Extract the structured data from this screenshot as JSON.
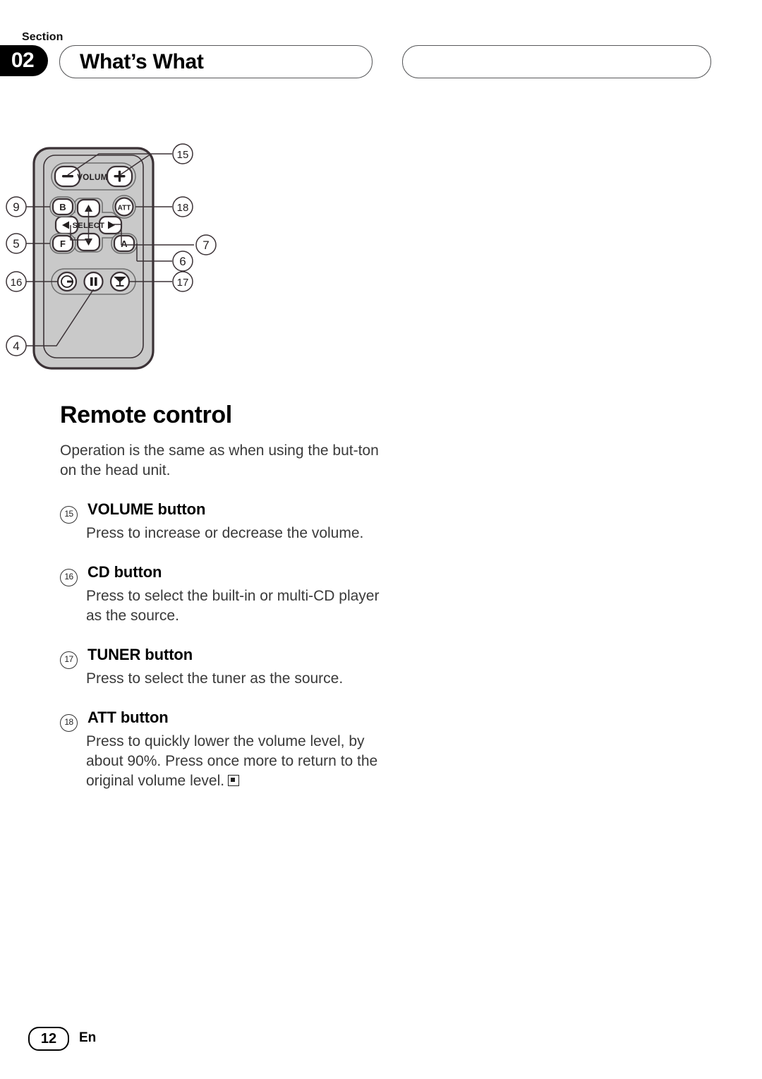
{
  "header": {
    "section_label": "Section",
    "section_number": "02",
    "chapter_title": "What’s What",
    "right_pill_text": ""
  },
  "figure": {
    "caption_alt": "remote-control-diagram",
    "remote": {
      "volume_label": "VOLUME",
      "select_label": "SELECT",
      "att_label": "ATT",
      "button_b": "B",
      "button_f": "F",
      "button_a": "A",
      "arrow_up": "▲",
      "arrow_down": "▼",
      "arrow_left": "◀",
      "arrow_right": "▶",
      "minus": "−",
      "plus": "+",
      "pause_icon": "pause-icon",
      "cd_source_icon": "cd-source-icon",
      "tuner_icon": "tuner-antenna-icon",
      "body_fill": "#c9c9c9",
      "body_stroke": "#3b3236"
    },
    "callouts": [
      {
        "id": "15",
        "side": "right",
        "targets": "volume-buttons"
      },
      {
        "id": "9",
        "side": "left",
        "targets": "button-b"
      },
      {
        "id": "18",
        "side": "right",
        "targets": "att-button"
      },
      {
        "id": "7",
        "side": "right",
        "targets": "select-pad"
      },
      {
        "id": "5",
        "side": "left",
        "targets": "button-f"
      },
      {
        "id": "6",
        "side": "right",
        "targets": "button-a"
      },
      {
        "id": "16",
        "side": "left",
        "targets": "cd-button"
      },
      {
        "id": "17",
        "side": "right",
        "targets": "tuner-button"
      },
      {
        "id": "4",
        "side": "left",
        "targets": "pause-button"
      }
    ]
  },
  "content": {
    "heading": "Remote control",
    "intro": "Operation is the same as when using the but-ton on the head unit.",
    "entries": [
      {
        "number": "15",
        "title": "VOLUME button",
        "description": "Press to increase or decrease the volume."
      },
      {
        "number": "16",
        "title": "CD button",
        "description": "Press to select the built-in or multi-CD player as the source."
      },
      {
        "number": "17",
        "title": "TUNER button",
        "description": "Press to select the tuner as the source."
      },
      {
        "number": "18",
        "title": "ATT button",
        "description": "Press to quickly lower the volume level, by about 90%. Press once more to return to the original volume level."
      }
    ],
    "end_of_section_marker": true
  },
  "footer": {
    "page_number": "12",
    "language": "En"
  }
}
